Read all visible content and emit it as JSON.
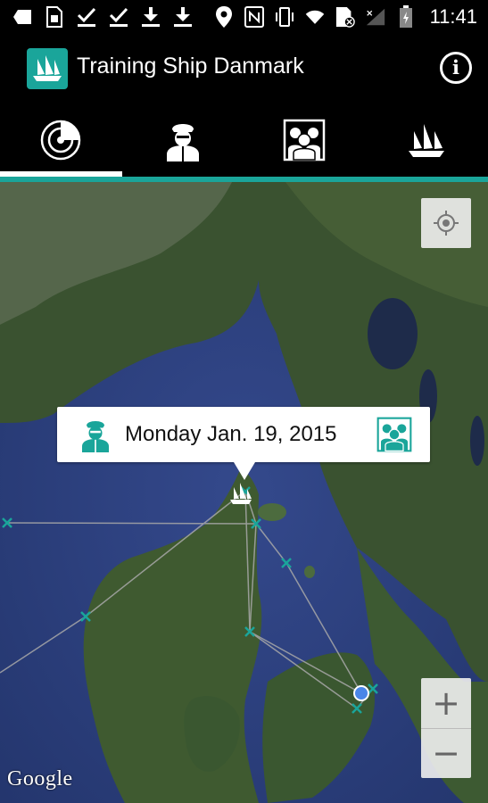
{
  "app": {
    "title": "Training Ship Danmark"
  },
  "status_bar": {
    "time": "11:41",
    "left_icons": [
      "notification-back-icon",
      "sim-icon",
      "check-icon",
      "check-icon",
      "download-icon",
      "download-icon"
    ],
    "right_icons": [
      "location-pin-icon",
      "nfc-icon",
      "vibrate-icon",
      "wifi-icon",
      "no-sim-icon",
      "signal-icon",
      "battery-icon"
    ]
  },
  "tabs": [
    {
      "name": "tab-position",
      "icon": "radar-icon",
      "selected": true
    },
    {
      "name": "tab-captain",
      "icon": "captain-icon",
      "selected": false
    },
    {
      "name": "tab-crew",
      "icon": "crew-icon",
      "selected": false
    },
    {
      "name": "tab-ship",
      "icon": "ship-icon",
      "selected": false
    }
  ],
  "map": {
    "callout": {
      "date": "Monday Jan. 19, 2015"
    },
    "zoom_in": "+",
    "zoom_out": "−",
    "attribution": "Google"
  },
  "colors": {
    "accent": "#1aa59a",
    "appbar": "#000000"
  }
}
